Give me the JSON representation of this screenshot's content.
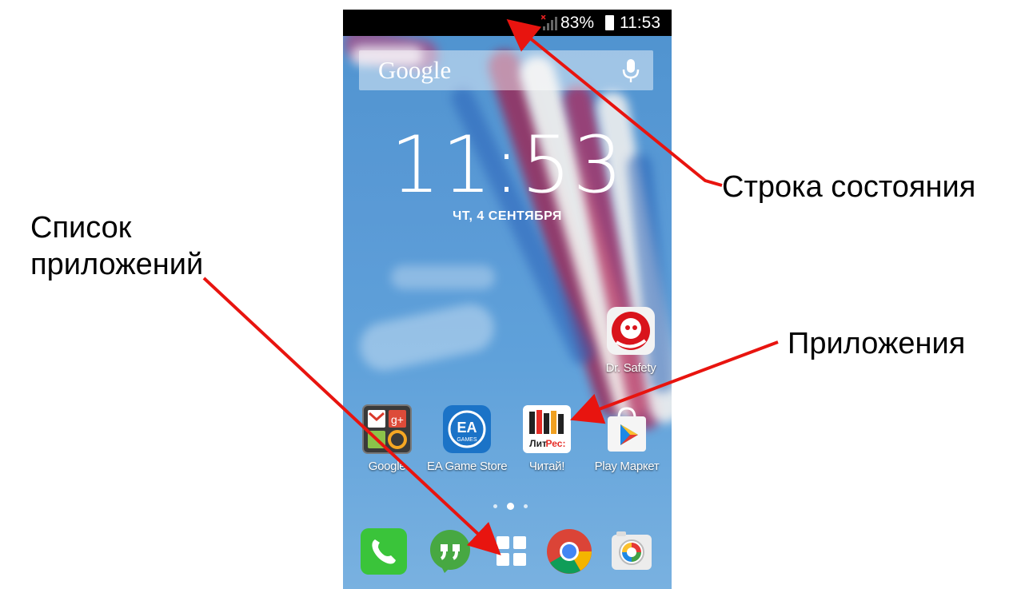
{
  "annotations": {
    "status_bar": "Строка состояния",
    "app_list_line1": "Список",
    "app_list_line2": "приложений",
    "apps": "Приложения"
  },
  "status_bar": {
    "battery_percent": "83%",
    "time": "11:53",
    "icons": [
      "no-signal-icon",
      "battery-icon"
    ]
  },
  "search_widget": {
    "logo": "Google",
    "icon": "microphone-icon"
  },
  "clock_widget": {
    "time": "11:53",
    "date": "ЧТ, 4 СЕНТЯБРЯ"
  },
  "apps": {
    "dr_safety": {
      "label": "Dr. Safety"
    },
    "google_folder": {
      "label": "Google"
    },
    "ea_game_store": {
      "label": "EA Game Store",
      "icon_text_top": "EA",
      "icon_text_bottom": "GAMES"
    },
    "litres": {
      "label": "Читай!",
      "icon_text": "Лит",
      "icon_text_accent": "Рес:"
    },
    "play_market": {
      "label": "Play Маркет"
    }
  },
  "page_indicator": {
    "count": 3,
    "active_index": 1
  },
  "dock": [
    "phone-icon",
    "hangouts-icon",
    "app-drawer-icon",
    "chrome-icon",
    "camera-icon"
  ],
  "colors": {
    "arrow": "#e8140f",
    "status_bar_bg": "#000000",
    "wallpaper_sky": "#5a9ad6",
    "phone_green": "#3ac43a",
    "hangouts_green": "#47a842",
    "ea_blue": "#1b73c7"
  }
}
